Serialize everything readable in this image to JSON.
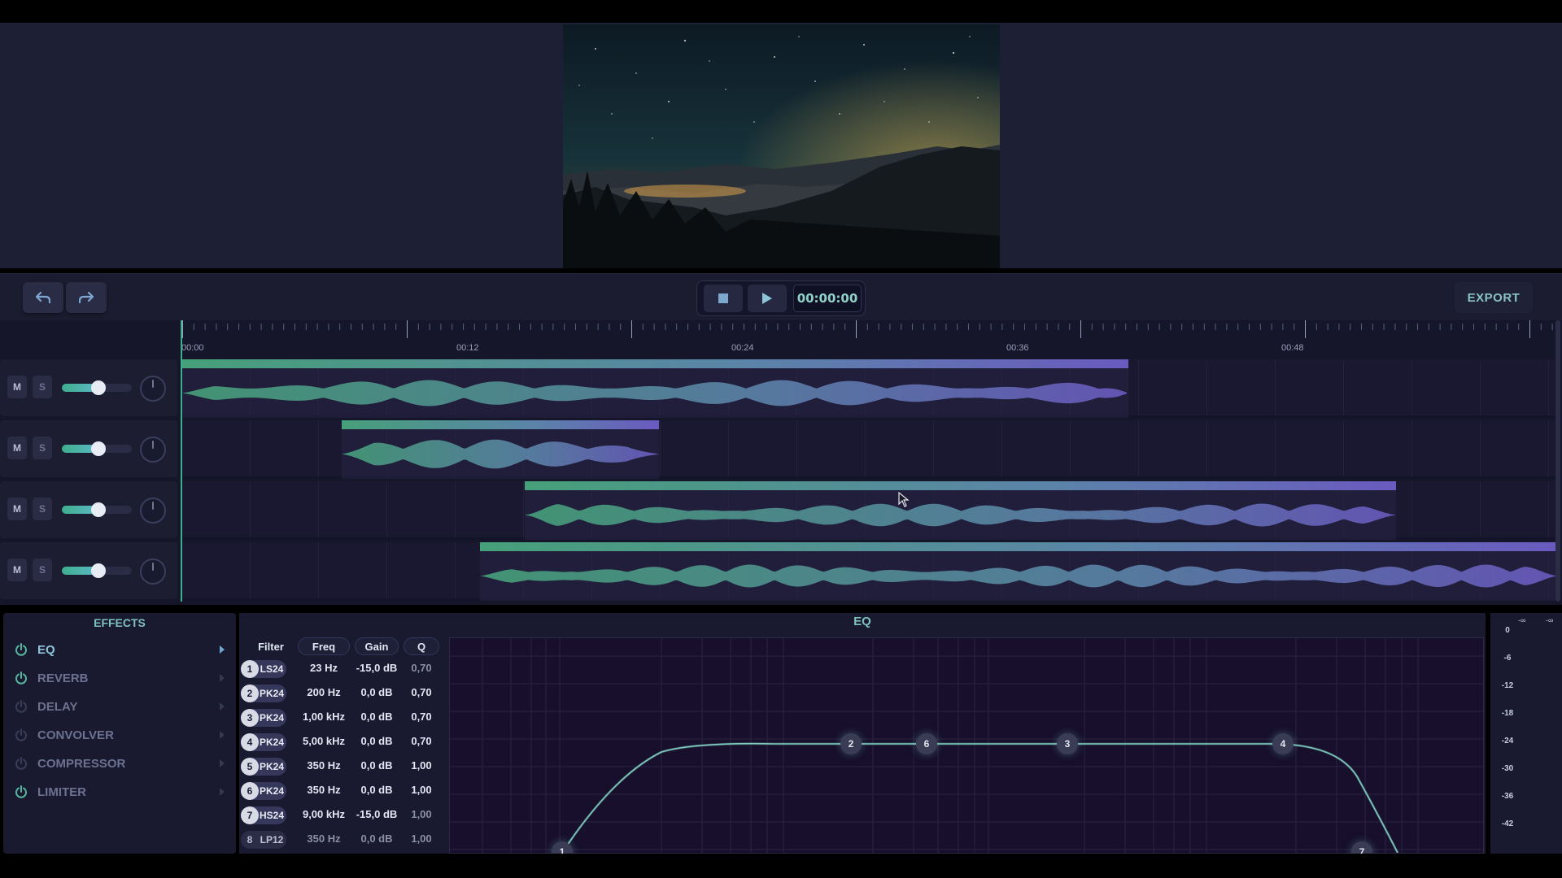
{
  "toolbar": {
    "export_label": "EXPORT",
    "timecode": "00:00:00"
  },
  "ruler": {
    "labels": [
      "00:00",
      "00:12",
      "00:24",
      "00:36",
      "00:48"
    ]
  },
  "tracks": [
    {
      "mute_label": "M",
      "solo_label": "S",
      "volume": 0.55
    },
    {
      "mute_label": "M",
      "solo_label": "S",
      "volume": 0.55
    },
    {
      "mute_label": "M",
      "solo_label": "S",
      "volume": 0.55
    },
    {
      "mute_label": "M",
      "solo_label": "S",
      "volume": 0.55
    }
  ],
  "effects": {
    "title": "EFFECTS",
    "items": [
      {
        "label": "EQ",
        "enabled": true
      },
      {
        "label": "REVERB",
        "enabled": true
      },
      {
        "label": "DELAY",
        "enabled": false
      },
      {
        "label": "CONVOLVER",
        "enabled": false
      },
      {
        "label": "COMPRESSOR",
        "enabled": false
      },
      {
        "label": "LIMITER",
        "enabled": true
      }
    ]
  },
  "eq": {
    "title": "EQ",
    "headers": {
      "filter": "Filter",
      "freq": "Freq",
      "gain": "Gain",
      "q": "Q"
    },
    "bands": [
      {
        "num": "1",
        "type": "LS24",
        "freq": "23 Hz",
        "gain": "-15,0 dB",
        "q": "0,70"
      },
      {
        "num": "2",
        "type": "PK24",
        "freq": "200 Hz",
        "gain": "0,0 dB",
        "q": "0,70"
      },
      {
        "num": "3",
        "type": "PK24",
        "freq": "1,00 kHz",
        "gain": "0,0 dB",
        "q": "0,70"
      },
      {
        "num": "4",
        "type": "PK24",
        "freq": "5,00 kHz",
        "gain": "0,0 dB",
        "q": "0,70"
      },
      {
        "num": "5",
        "type": "PK24",
        "freq": "350 Hz",
        "gain": "0,0 dB",
        "q": "1,00"
      },
      {
        "num": "6",
        "type": "PK24",
        "freq": "350 Hz",
        "gain": "0,0 dB",
        "q": "1,00"
      },
      {
        "num": "7",
        "type": "HS24",
        "freq": "9,00 kHz",
        "gain": "-15,0 dB",
        "q": "1,00"
      },
      {
        "num": "8",
        "type": "LP12",
        "freq": "350 Hz",
        "gain": "0,0 dB",
        "q": "1,00"
      }
    ],
    "nodes": [
      "1",
      "2",
      "6",
      "3",
      "4",
      "7"
    ]
  },
  "meter": {
    "top_left": "-∞",
    "top_right": "-∞",
    "scale": [
      "0",
      "-6",
      "-12",
      "-18",
      "-24",
      "-30",
      "-36",
      "-42"
    ]
  },
  "colors": {
    "accent": "#7fc1bd",
    "wave_start": "#46a07a",
    "wave_end": "#6a5ac0"
  }
}
